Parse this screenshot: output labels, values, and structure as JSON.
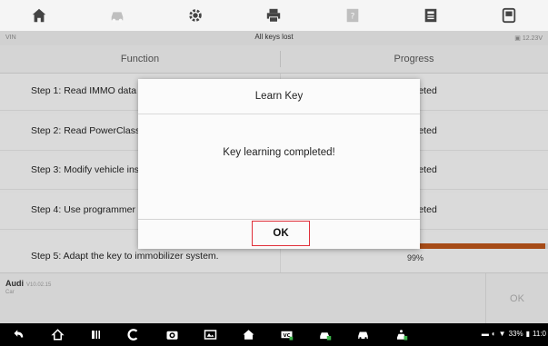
{
  "toolbar": {
    "items": [
      {
        "name": "home-icon",
        "enabled": true
      },
      {
        "name": "vehicle-swap-icon",
        "enabled": false
      },
      {
        "name": "settings-icon",
        "enabled": true
      },
      {
        "name": "print-icon",
        "enabled": true
      },
      {
        "name": "help-icon",
        "enabled": false
      },
      {
        "name": "save-icon",
        "enabled": true
      },
      {
        "name": "data-logging-icon",
        "enabled": true
      }
    ]
  },
  "infobar": {
    "vin_label": "VIN",
    "title": "All keys lost",
    "voltage": "12.23V"
  },
  "table": {
    "headers": {
      "function": "Function",
      "progress": "Progress"
    },
    "rows": [
      {
        "function": "Step 1: Read IMMO data from vehicle engine.",
        "progress": "Completed"
      },
      {
        "function": "Step 2: Read PowerClass from vehicle engine.",
        "progress": "Completed"
      },
      {
        "function": "Step 3: Modify vehicle instrument IMMO data.",
        "progress": "Completed"
      },
      {
        "function": "Step 4: Use programmer to make a dealer key.",
        "progress": "Completed"
      },
      {
        "function": "Step 5: Adapt the key to immobilizer system.",
        "progress": "99%"
      }
    ],
    "progress_fraction": 0.99
  },
  "footer": {
    "make": "Audi",
    "version": "V10.02.15",
    "category": "Car",
    "ok_label": "OK"
  },
  "dialog": {
    "title": "Learn Key",
    "message": "Key learning completed!",
    "ok_label": "OK"
  },
  "navbar": {
    "items": [
      "back-icon",
      "home-icon",
      "recent-apps-icon",
      "browser-icon",
      "camera-icon",
      "screenshot-icon",
      "maxisys-home-icon",
      "vci-icon",
      "vehicle-icon",
      "vehicle-icon",
      "remote-icon"
    ],
    "status": {
      "battery": "33%",
      "time": "11:0"
    }
  },
  "colors": {
    "accent": "#b5521a",
    "ok_border": "#e0303a"
  }
}
